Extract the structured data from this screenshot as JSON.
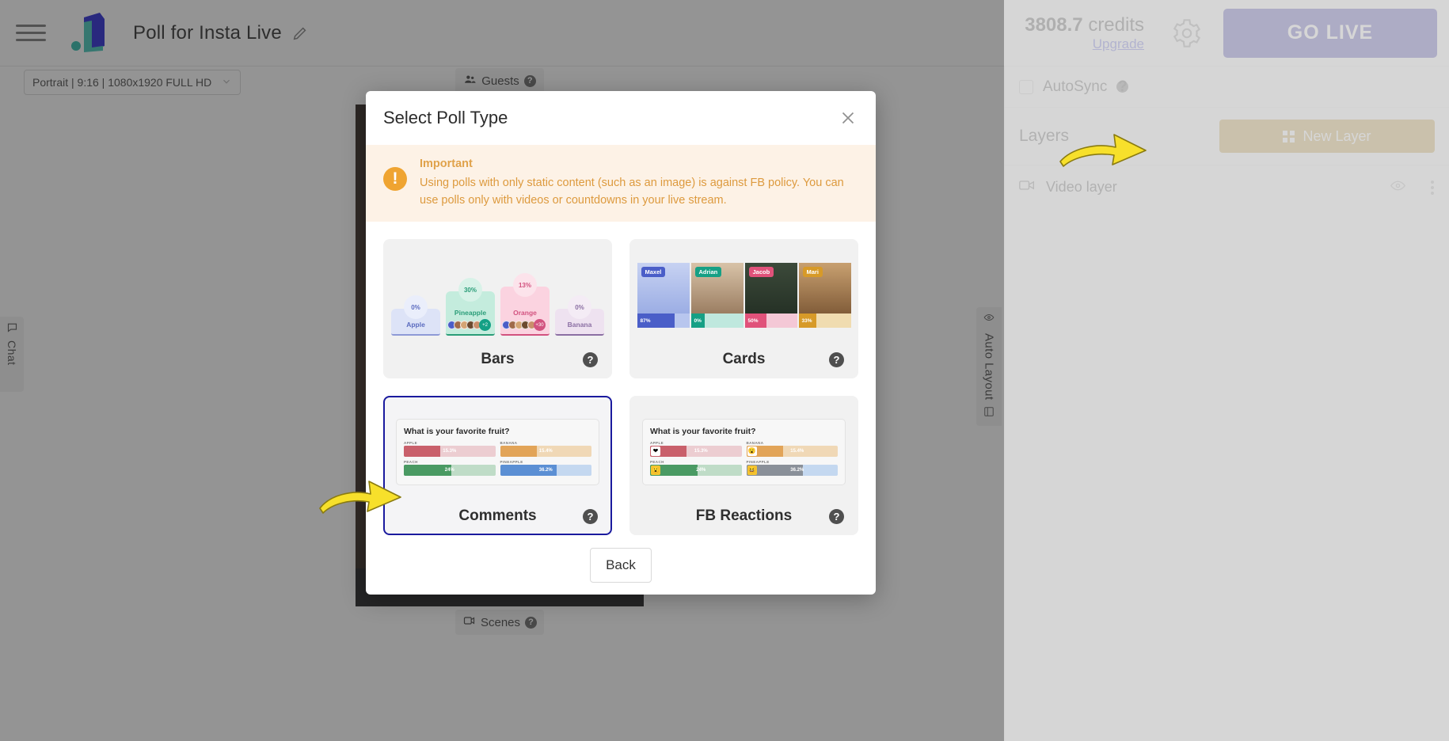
{
  "topbar": {
    "menu_icon": "hamburger-icon",
    "logo_icon": "brand-logo",
    "project_title": "Poll for Insta Live",
    "edit_icon": "pencil-icon",
    "credits_value": "3808.7",
    "credits_label": "credits",
    "upgrade_link": "Upgrade",
    "settings_icon": "gear-icon",
    "go_live_label": "GO LIVE"
  },
  "subbar": {
    "resolution_value": "Portrait | 9:16 | 1080x1920 FULL HD",
    "chevron_icon": "chevron-down-icon",
    "guests_label": "Guests",
    "guests_icon": "people-icon",
    "scenes_label": "Scenes",
    "scenes_icon": "scenes-icon",
    "help_icon": "question-mark-icon"
  },
  "side_tabs": {
    "chat_label": "Chat",
    "chat_icon": "chat-bubble-icon",
    "auto_layout_label": "Auto Layout",
    "auto_layout_top_icon": "eye-icon",
    "auto_layout_bottom_icon": "layout-icon"
  },
  "right_panel": {
    "autosync_label": "AutoSync",
    "autosync_checked": false,
    "layers_title": "Layers",
    "new_layer_label": "New Layer",
    "new_layer_icon": "grid-icon",
    "new_layer_color": "#b8860b",
    "layers": [
      {
        "name": "Video layer",
        "type_icon": "video-camera-icon",
        "visibility_icon": "eye-icon",
        "menu_icon": "kebab-menu-icon"
      }
    ]
  },
  "modal": {
    "title": "Select Poll Type",
    "close_icon": "close-icon",
    "alert": {
      "icon": "exclamation-icon",
      "title": "Important",
      "text": "Using polls with only static content (such as an image) is against FB policy. You can use polls only with videos or countdowns in your live stream.",
      "bg_color": "#fdf2e6",
      "text_color": "#dd9a3e"
    },
    "poll_types": [
      {
        "id": "bars",
        "label": "Bars",
        "help_icon": "question-mark-icon",
        "selected": false
      },
      {
        "id": "cards",
        "label": "Cards",
        "help_icon": "question-mark-icon",
        "selected": false
      },
      {
        "id": "comments",
        "label": "Comments",
        "help_icon": "question-mark-icon",
        "selected": true
      },
      {
        "id": "fb_reactions",
        "label": "FB Reactions",
        "help_icon": "question-mark-icon",
        "selected": false
      }
    ],
    "back_label": "Back"
  },
  "previews": {
    "bars": {
      "options": [
        {
          "name": "Apple",
          "percent": "0%",
          "bg": "#dde3f7",
          "fg": "#5b6bbf",
          "pct_bg": "#eaeefb"
        },
        {
          "name": "Pineapple",
          "percent": "30%",
          "bg": "#c4ecdd",
          "fg": "#2a9d78",
          "pct_bg": "#d8f2e8"
        },
        {
          "name": "Orange",
          "percent": "13%",
          "bg": "#fbd3e0",
          "fg": "#d2527f",
          "pct_bg": "#fce3eb"
        },
        {
          "name": "Banana",
          "percent": "0%",
          "bg": "#eee2f0",
          "fg": "#8b6fa3",
          "pct_bg": "#f4ecf5"
        }
      ],
      "avatar_more_labels": [
        "+2",
        "+30"
      ]
    },
    "cards": {
      "people": [
        {
          "name": "Maxel",
          "percent": "87%",
          "accent": "#4a5ec8",
          "tint": "#c7d2f2"
        },
        {
          "name": "Adrian",
          "percent": "0%",
          "accent": "#16a085",
          "tint": "#bfe8de"
        },
        {
          "name": "Jacob",
          "percent": "50%",
          "accent": "#e0527a",
          "tint": "#f4c8d6"
        },
        {
          "name": "Mari",
          "percent": "33%",
          "accent": "#d79a28",
          "tint": "#f0dcb0"
        }
      ]
    },
    "poll_board": {
      "question": "What is your favorite fruit?",
      "items": [
        {
          "label": "APPLE",
          "value": "15.3%",
          "color": "#c9606b",
          "track": "#eccdd1",
          "emoji": "❤",
          "emoji_bg": "#c9606b"
        },
        {
          "label": "BANANA",
          "value": "15.4%",
          "color": "#e2a458",
          "track": "#f0d8b6",
          "emoji": "😮",
          "emoji_bg": "#e2a458"
        },
        {
          "label": "PEACH",
          "value": "24%",
          "color": "#4a9a63",
          "track": "#bfdcc7",
          "emoji": "😮",
          "emoji_bg": "#4a9a63"
        },
        {
          "label": "PINEAPPLE",
          "value": "36.2%",
          "color": "#5b8fd4",
          "track": "#c4d8f0",
          "emoji": "😆",
          "emoji_bg": "#5b8fd4"
        }
      ],
      "fills": [
        "40",
        "40",
        "52",
        "62"
      ]
    }
  },
  "annotations": {
    "arrow_color": "#f7e02b",
    "arrows": [
      "arrow-to-new-layer",
      "arrow-to-comments-card"
    ]
  }
}
